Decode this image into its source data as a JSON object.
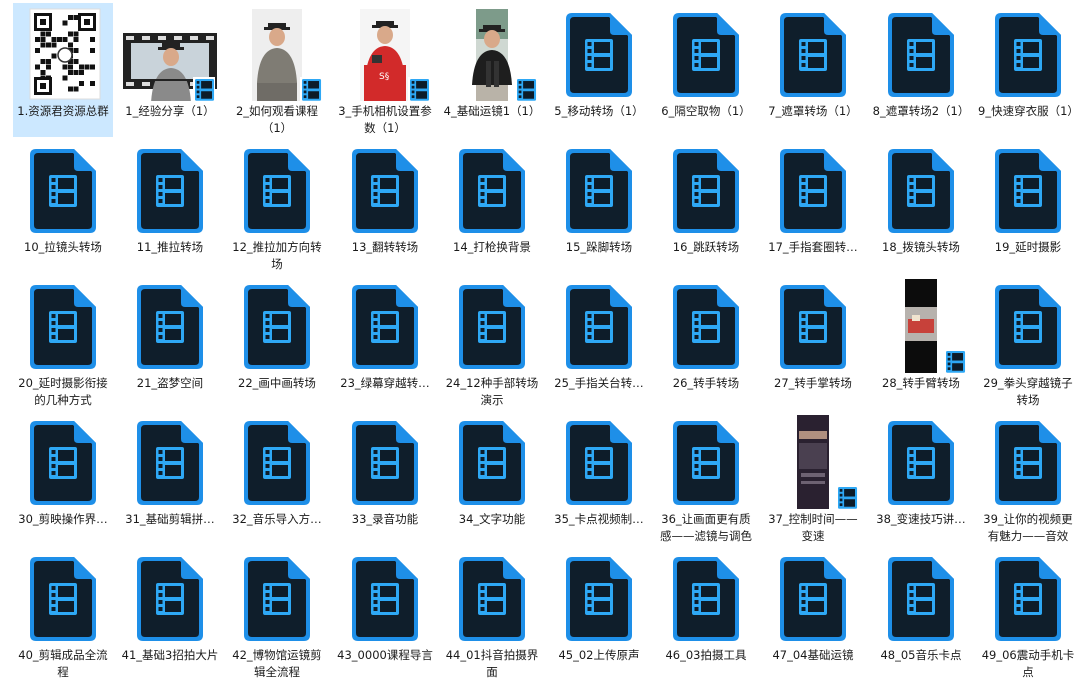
{
  "files": [
    {
      "name": "1.资源君资源总群",
      "kind": "qr",
      "selected": true
    },
    {
      "name": "1_经验分享（1）",
      "kind": "video-wide"
    },
    {
      "name": "2_如何观看课程（1）",
      "kind": "photo-grey"
    },
    {
      "name": "3_手机相机设置参数（1）",
      "kind": "photo-red"
    },
    {
      "name": "4_基础运镜1（1）",
      "kind": "photo-street"
    },
    {
      "name": "5_移动转场（1）",
      "kind": "video"
    },
    {
      "name": "6_隔空取物（1）",
      "kind": "video"
    },
    {
      "name": "7_遮罩转场（1）",
      "kind": "video"
    },
    {
      "name": "8_遮罩转场2（1）",
      "kind": "video"
    },
    {
      "name": "9_快速穿衣服（1）",
      "kind": "video"
    },
    {
      "name": "10_拉镜头转场",
      "kind": "video"
    },
    {
      "name": "11_推拉转场",
      "kind": "video"
    },
    {
      "name": "12_推拉加方向转场",
      "kind": "video"
    },
    {
      "name": "13_翻转转场",
      "kind": "video"
    },
    {
      "name": "14_打枪换背景",
      "kind": "video"
    },
    {
      "name": "15_跺脚转场",
      "kind": "video"
    },
    {
      "name": "16_跳跃转场",
      "kind": "video"
    },
    {
      "name": "17_手指套圈转…",
      "kind": "video"
    },
    {
      "name": "18_拨镜头转场",
      "kind": "video"
    },
    {
      "name": "19_延时摄影",
      "kind": "video"
    },
    {
      "name": "20_延时摄影衔接的几种方式",
      "kind": "video"
    },
    {
      "name": "21_盗梦空间",
      "kind": "video"
    },
    {
      "name": "22_画中画转场",
      "kind": "video"
    },
    {
      "name": "23_绿幕穿越转…",
      "kind": "video"
    },
    {
      "name": "24_12种手部转场演示",
      "kind": "video"
    },
    {
      "name": "25_手指关台转…",
      "kind": "video"
    },
    {
      "name": "26_转手转场",
      "kind": "video"
    },
    {
      "name": "27_转手掌转场",
      "kind": "video"
    },
    {
      "name": "28_转手臂转场",
      "kind": "photo-room"
    },
    {
      "name": "29_拳头穿越镜子转场",
      "kind": "video"
    },
    {
      "name": "30_剪映操作界…",
      "kind": "video"
    },
    {
      "name": "31_基础剪辑拼…",
      "kind": "video"
    },
    {
      "name": "32_音乐导入方…",
      "kind": "video"
    },
    {
      "name": "33_录音功能",
      "kind": "video"
    },
    {
      "name": "34_文字功能",
      "kind": "video"
    },
    {
      "name": "35_卡点视频制…",
      "kind": "video"
    },
    {
      "name": "36_让画面更有质感——滤镜与调色",
      "kind": "video"
    },
    {
      "name": "37_控制时间——变速",
      "kind": "photo-phone"
    },
    {
      "name": "38_变速技巧讲…",
      "kind": "video"
    },
    {
      "name": "39_让你的视频更有魅力——音效",
      "kind": "video"
    },
    {
      "name": "40_剪辑成品全流程",
      "kind": "video"
    },
    {
      "name": "41_基础3招拍大片",
      "kind": "video"
    },
    {
      "name": "42_博物馆运镜剪辑全流程",
      "kind": "video"
    },
    {
      "name": "43_0000课程导言",
      "kind": "video"
    },
    {
      "name": "44_01抖音拍摄界面",
      "kind": "video"
    },
    {
      "name": "45_02上传原声",
      "kind": "video"
    },
    {
      "name": "46_03拍摄工具",
      "kind": "video"
    },
    {
      "name": "47_04基础运镜",
      "kind": "video"
    },
    {
      "name": "48_05音乐卡点",
      "kind": "video"
    },
    {
      "name": "49_06震动手机卡点",
      "kind": "video"
    }
  ],
  "colors": {
    "icon_body": "#0f1e2b",
    "icon_blue": "#1e8fe8",
    "film_cyan": "#2ea8f5",
    "selection": "#cce8ff"
  }
}
